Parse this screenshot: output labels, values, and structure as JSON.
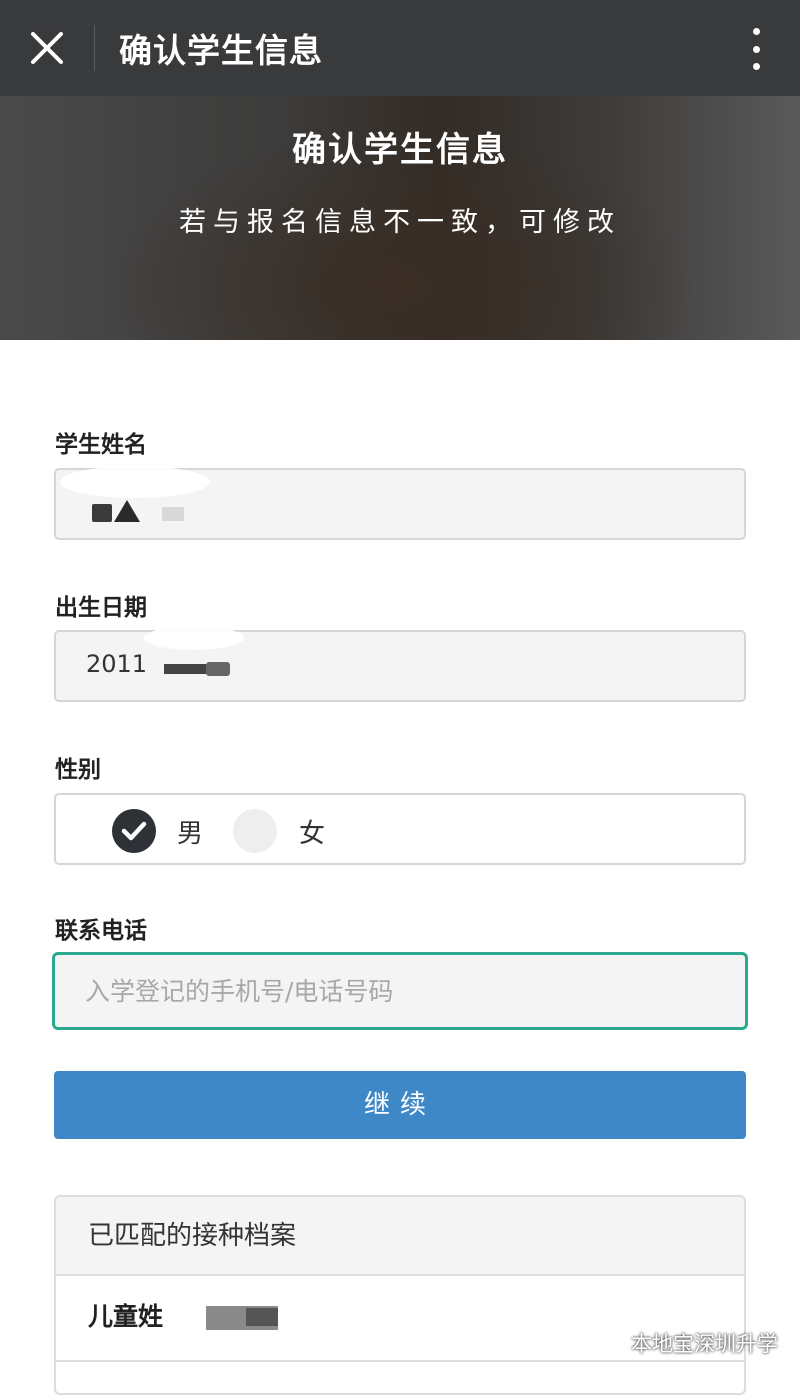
{
  "topbar": {
    "title": "确认学生信息"
  },
  "banner": {
    "title": "确认学生信息",
    "subtitle": "若与报名信息不一致，可修改"
  },
  "form": {
    "name_label": "学生姓名",
    "birth_label": "出生日期",
    "birth_value": "2011",
    "gender_label": "性别",
    "gender_male": "男",
    "gender_female": "女",
    "gender_selected": "男",
    "phone_label": "联系电话",
    "phone_placeholder": "入学登记的手机号/电话号码",
    "continue_label": "继续"
  },
  "vaccine_panel": {
    "header": "已匹配的接种档案",
    "child_name_label": "儿童姓"
  },
  "watermark": {
    "text": "本地宝深圳升学"
  },
  "colors": {
    "topbar": "#393a3c",
    "accent_teal": "#2aa98f",
    "button_blue": "#3e88c8"
  }
}
